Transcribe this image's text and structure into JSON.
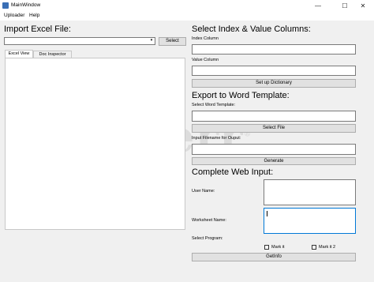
{
  "window": {
    "title": "MainWindow",
    "controls": {
      "minimize": "—",
      "maximize": "☐",
      "close": "✕"
    }
  },
  "menu": {
    "items": [
      "Uploader",
      "Help"
    ]
  },
  "import": {
    "heading": "Import Excel File:",
    "file_value": "",
    "select_label": "Select",
    "tabs": [
      "Excel View",
      "Doc Inspector"
    ]
  },
  "index_value": {
    "heading": "Select Index & Value Columns:",
    "index_label": "Index Column",
    "index_value": "",
    "value_label": "Value Column",
    "value_value": "",
    "setup_label": "Set up Dictionary"
  },
  "export": {
    "heading": "Export to Word Template:",
    "select_template_label": "Select Word Template:",
    "template_value": "",
    "select_file_label": "Select File",
    "input_filename_label": "Input Filename for Ouput:",
    "filename_value": "",
    "generate_label": "Generate"
  },
  "web": {
    "heading": "Complete Web Input:",
    "user_name_label": "User Name:",
    "worksheet_name_label": "Worksheet Name:",
    "select_program_label": "Select Program:",
    "mark1_label": "Mark it",
    "mark2_label": "Mark it 2",
    "getinfo_label": "GetInfo"
  },
  "watermark": "fiverr",
  "watermark_mark": "®"
}
